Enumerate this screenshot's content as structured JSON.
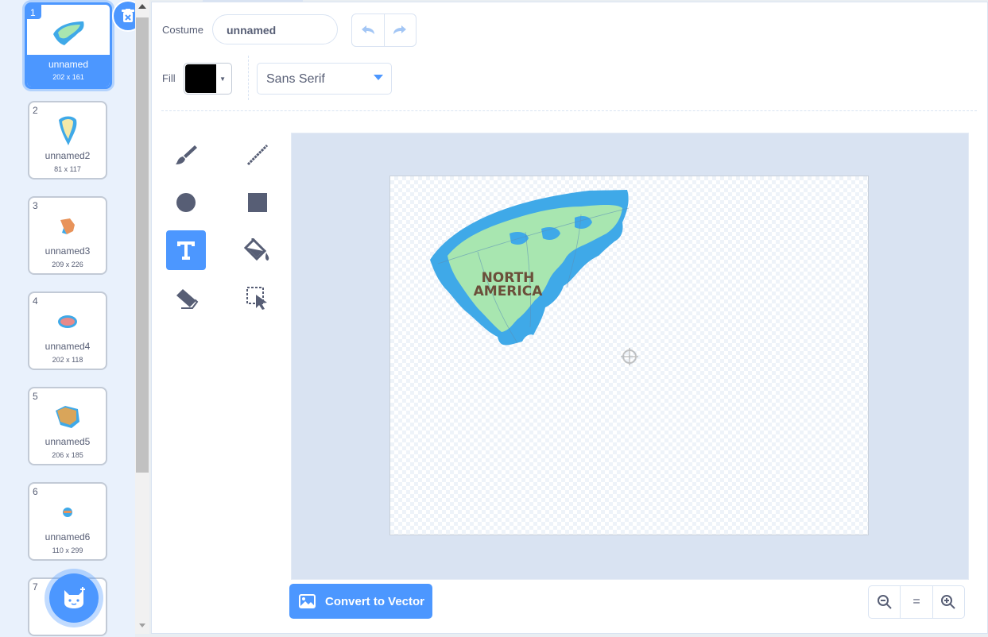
{
  "costumes": [
    {
      "index": "1",
      "name": "unnamed",
      "size": "202 x 161",
      "selected": true
    },
    {
      "index": "2",
      "name": "unnamed2",
      "size": "81 x 117"
    },
    {
      "index": "3",
      "name": "unnamed3",
      "size": "209 x 226"
    },
    {
      "index": "4",
      "name": "unnamed4",
      "size": "202 x 118"
    },
    {
      "index": "5",
      "name": "unnamed5",
      "size": "206 x 185"
    },
    {
      "index": "6",
      "name": "unnamed6",
      "size": "110 x 299"
    },
    {
      "index": "7",
      "name": "",
      "size": ""
    }
  ],
  "editor": {
    "costume_label": "Costume",
    "costume_name": "unnamed",
    "fill_label": "Fill",
    "fill_color": "#000000",
    "font_value": "Sans Serif",
    "active_tool": "text-tool",
    "canvas_text_line1": "NORTH",
    "canvas_text_line2": "AMERICA",
    "convert_label": "Convert to Vector",
    "zoom_reset_label": "="
  },
  "colors": {
    "accent": "#4c97ff",
    "tool_icon": "#575e75",
    "map_ocean": "#3fa9e8",
    "map_land": "#a8e6b0",
    "map_text": "#6b4f3a"
  },
  "icons": [
    "delete-icon",
    "add-costume-cat-icon",
    "undo-icon",
    "redo-icon",
    "brush-icon",
    "line-icon",
    "circle-icon",
    "rectangle-icon",
    "text-icon",
    "fill-bucket-icon",
    "eraser-icon",
    "select-icon",
    "image-icon",
    "zoom-out-icon",
    "zoom-in-icon",
    "costume-center-icon"
  ]
}
